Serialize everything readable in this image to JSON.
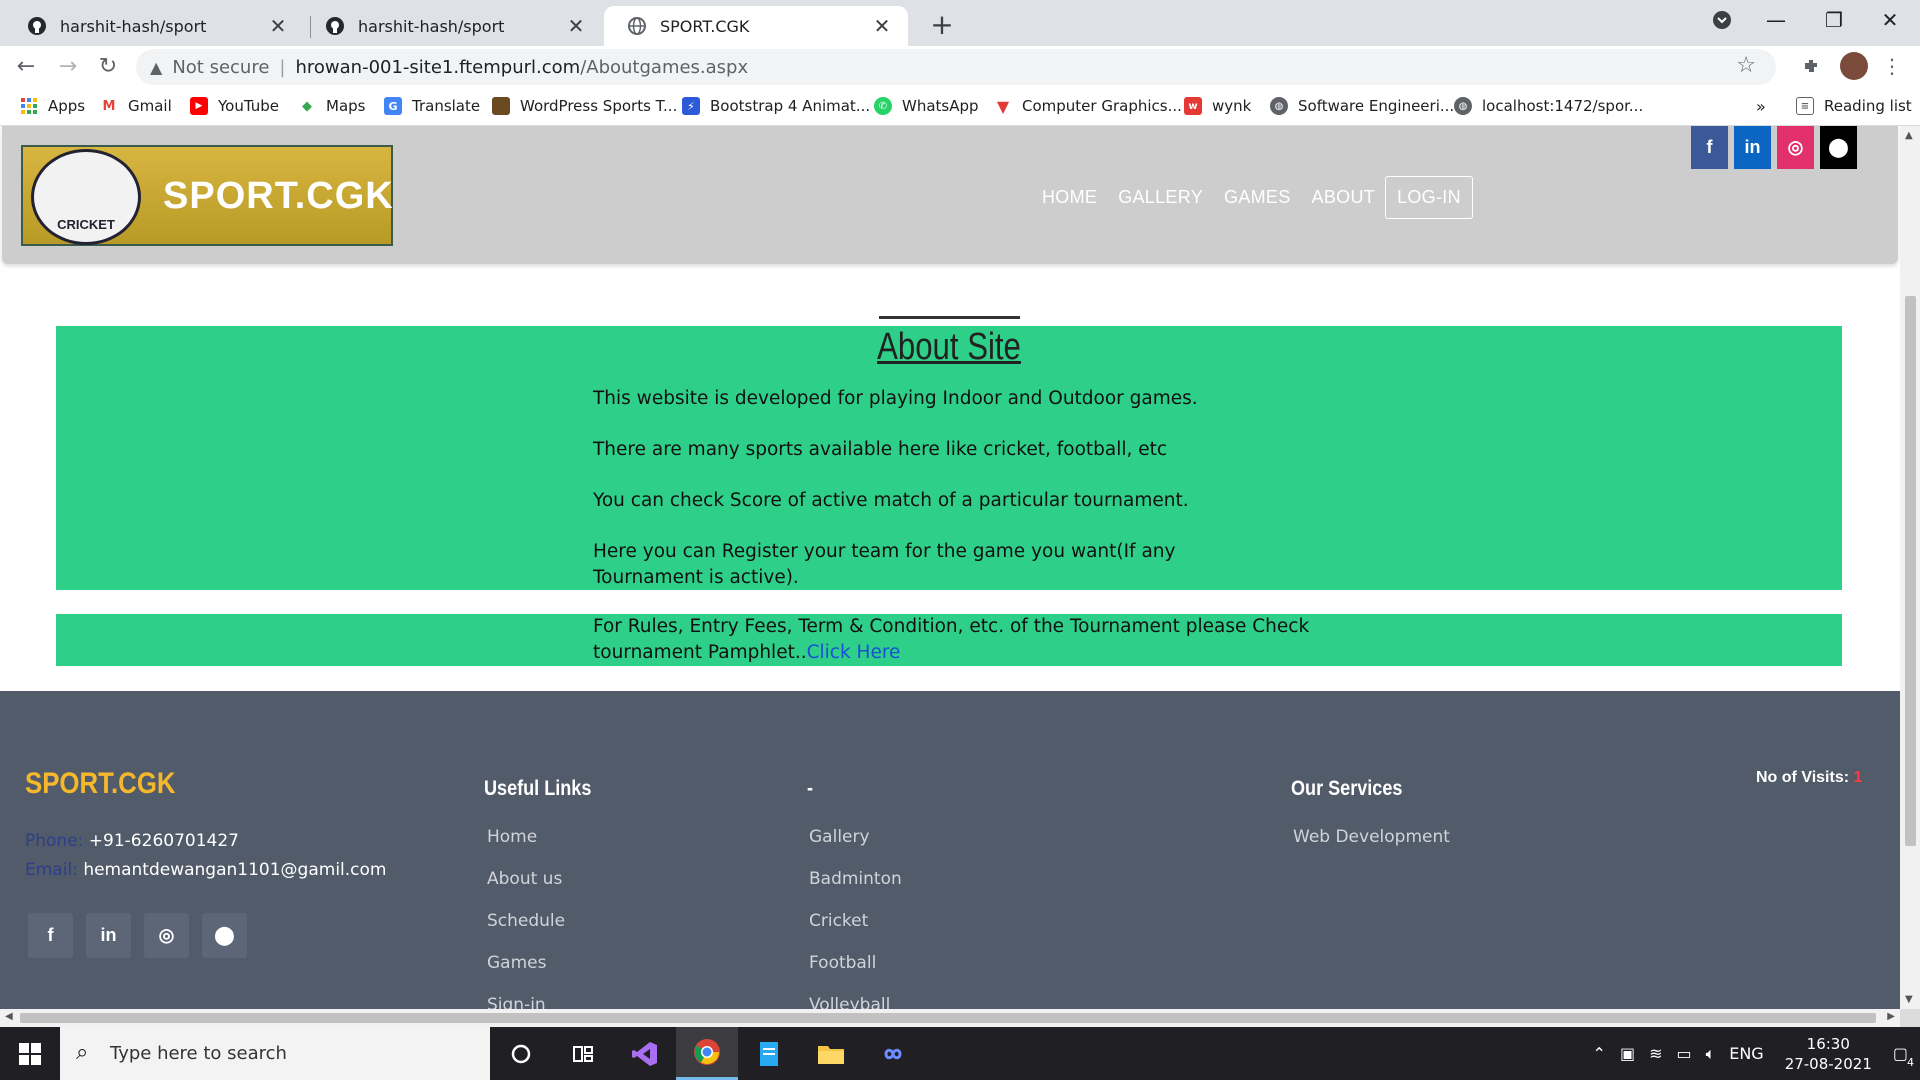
{
  "browser": {
    "tabs": [
      {
        "title": "harshit-hash/sport",
        "active": false,
        "icon": "github-icon"
      },
      {
        "title": "harshit-hash/sport",
        "active": false,
        "icon": "github-icon"
      },
      {
        "title": "SPORT.CGK",
        "active": true,
        "icon": "globe-icon"
      }
    ],
    "address": {
      "security_label": "Not secure",
      "host": "hrowan-001-site1.ftempurl.com",
      "path": "/Aboutgames.aspx"
    },
    "bookmarks": [
      {
        "label": "Apps",
        "icon": "apps-grid-icon"
      },
      {
        "label": "Gmail",
        "icon": "gmail-icon"
      },
      {
        "label": "YouTube",
        "icon": "youtube-icon"
      },
      {
        "label": "Maps",
        "icon": "maps-icon"
      },
      {
        "label": "Translate",
        "icon": "translate-icon"
      },
      {
        "label": "WordPress Sports T...",
        "icon": "wordpress-icon"
      },
      {
        "label": "Bootstrap 4 Animat...",
        "icon": "bootstrap-icon"
      },
      {
        "label": "WhatsApp",
        "icon": "whatsapp-icon"
      },
      {
        "label": "Computer Graphics...",
        "icon": "graphics-icon"
      },
      {
        "label": "wynk",
        "icon": "wynk-icon"
      },
      {
        "label": "Software Engineeri...",
        "icon": "globe-icon"
      },
      {
        "label": "localhost:1472/spor...",
        "icon": "globe-icon"
      }
    ],
    "overflow": "»",
    "reading_list": "Reading list"
  },
  "site": {
    "logo_text": "SPORT.CGK",
    "logo_emblem": "CRICKET",
    "social_top": [
      {
        "name": "facebook",
        "glyph": "f",
        "color": "#3b5998"
      },
      {
        "name": "linkedin",
        "glyph": "in",
        "color": "#0a66c2"
      },
      {
        "name": "instagram",
        "glyph": "◎",
        "color": "#e1306c"
      },
      {
        "name": "github",
        "glyph": "⬤",
        "color": "#000000"
      }
    ],
    "nav": [
      "HOME",
      "GALLERY",
      "GAMES",
      "ABOUT",
      "LOG-IN"
    ],
    "about": {
      "title": "About Site",
      "paragraphs": [
        "This website is developed for playing Indoor and Outdoor games.",
        "There are many sports available here like cricket, football, etc",
        "You can check Score of active match of a particular tournament.",
        "Here you can Register your team for the game you want(If any Tournament is active)."
      ],
      "rules_text": "For Rules, Entry Fees, Term & Condition, etc. of the Tournament please Check tournament Pamphlet..",
      "rules_link": "Click Here"
    },
    "footer": {
      "brand": "SPORT.CGK",
      "phone_label": "Phone:",
      "phone": "+91-6260701427",
      "email_label": "Email:",
      "email": "hemantdewangan1101@gamil.com",
      "socials": [
        "f",
        "in",
        "◎",
        "⬤"
      ],
      "useful_links_title": "Useful Links",
      "useful_links": [
        "Home",
        "About us",
        "Schedule",
        "Games",
        "Sign-in"
      ],
      "games_title": "-",
      "games_links": [
        "Gallery",
        "Badminton",
        "Cricket",
        "Football",
        "Volleyball"
      ],
      "services_title": "Our Services",
      "services": [
        "Web Development"
      ],
      "visits_label": "No of Visits:",
      "visits_value": "1"
    }
  },
  "taskbar": {
    "search_placeholder": "Type here to search",
    "language": "ENG",
    "time": "16:30",
    "date": "27-08-2021",
    "notifications": "4"
  },
  "colors": {
    "accent_green": "#2ecf89",
    "footer_bg": "#525b69",
    "brand_yellow": "#f5b82a",
    "header_gray": "#cdcdcd"
  }
}
